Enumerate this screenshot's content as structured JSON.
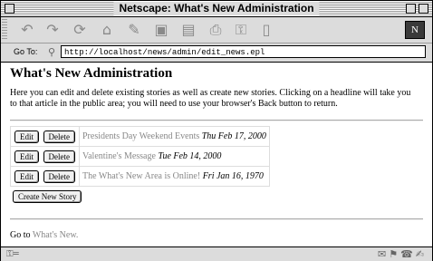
{
  "window": {
    "title": "Netscape: What's New Administration"
  },
  "location": {
    "label": "Go To:",
    "url": "http://localhost/news/admin/edit_news.epl"
  },
  "page": {
    "heading": "What's New Administration",
    "intro": "Here you can edit and delete existing stories as well as create new stories. Clicking on a headline will take you to that article in the public area; you will need to use your browser's Back button to return.",
    "edit_label": "Edit",
    "delete_label": "Delete",
    "stories": [
      {
        "headline": "Presidents Day Weekend Events",
        "date": "Thu Feb 17, 2000"
      },
      {
        "headline": "Valentine's Message",
        "date": "Tue Feb 14, 2000"
      },
      {
        "headline": "The What's New Area is Online!",
        "date": "Fri Jan 16, 1970"
      }
    ],
    "create_label": "Create New Story",
    "footer_prefix": "Go to",
    "footer_link": "What's New."
  },
  "icons": {
    "toolbar": [
      "back-icon",
      "forward-icon",
      "reload-icon",
      "home-icon",
      "search-icon",
      "guide-icon",
      "images-icon",
      "print-icon",
      "security-icon",
      "stop-icon"
    ],
    "logo": "netscape-logo-icon"
  }
}
